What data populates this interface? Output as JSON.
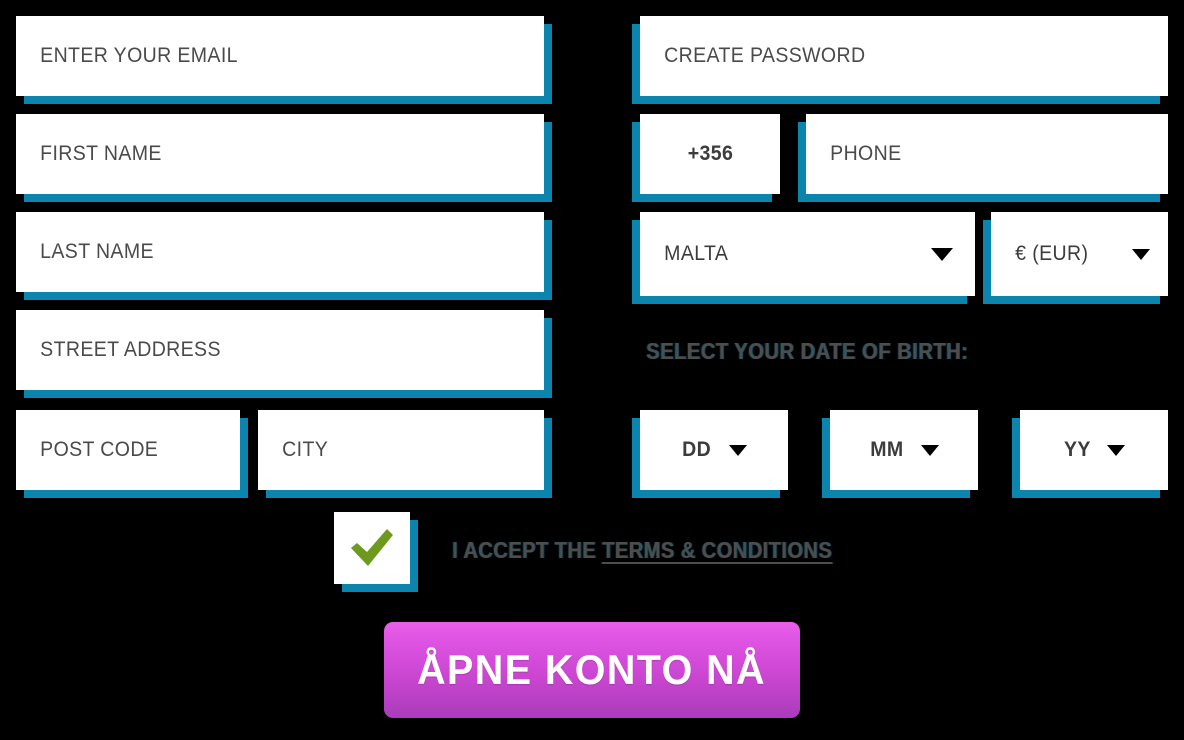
{
  "theme": {
    "background": "#000000",
    "field_background": "#ffffff",
    "accent_shadow": "#0b84ae",
    "placeholder_color": "#4a4a4a",
    "label_color": "#4d4d4d",
    "check_color": "#6d9a1e",
    "cta_gradient_top": "#e85fe8",
    "cta_gradient_bottom": "#a93cba",
    "cta_text_color": "#ffffff"
  },
  "form": {
    "left_column": {
      "email": {
        "placeholder": "ENTER YOUR EMAIL",
        "value": ""
      },
      "first_name": {
        "placeholder": "FIRST NAME",
        "value": ""
      },
      "last_name": {
        "placeholder": "LAST NAME",
        "value": ""
      },
      "street_address": {
        "placeholder": "STREET ADDRESS",
        "value": ""
      },
      "post_code": {
        "placeholder": "POST CODE",
        "value": ""
      },
      "city": {
        "placeholder": "CITY",
        "value": ""
      }
    },
    "right_column": {
      "password": {
        "placeholder": "CREATE PASSWORD",
        "value": ""
      },
      "dial_code": {
        "value": "+356"
      },
      "phone": {
        "placeholder": "PHONE",
        "value": ""
      },
      "country": {
        "value": "MALTA",
        "caret": "chevron-down-icon"
      },
      "currency": {
        "value": "€ (EUR)",
        "caret": "chevron-down-icon"
      },
      "dob_label": "SELECT YOUR DATE OF BIRTH:",
      "dob_day": {
        "value": "DD",
        "caret": "chevron-down-icon"
      },
      "dob_month": {
        "value": "MM",
        "caret": "chevron-down-icon"
      },
      "dob_year": {
        "value": "YY",
        "caret": "chevron-down-icon"
      }
    }
  },
  "consent": {
    "checked": true,
    "check_icon": "checkmark-icon",
    "text_prefix": "I ACCEPT THE ",
    "link_text": "TERMS & CONDITIONS"
  },
  "submit": {
    "label": "ÅPNE KONTO NÅ"
  }
}
